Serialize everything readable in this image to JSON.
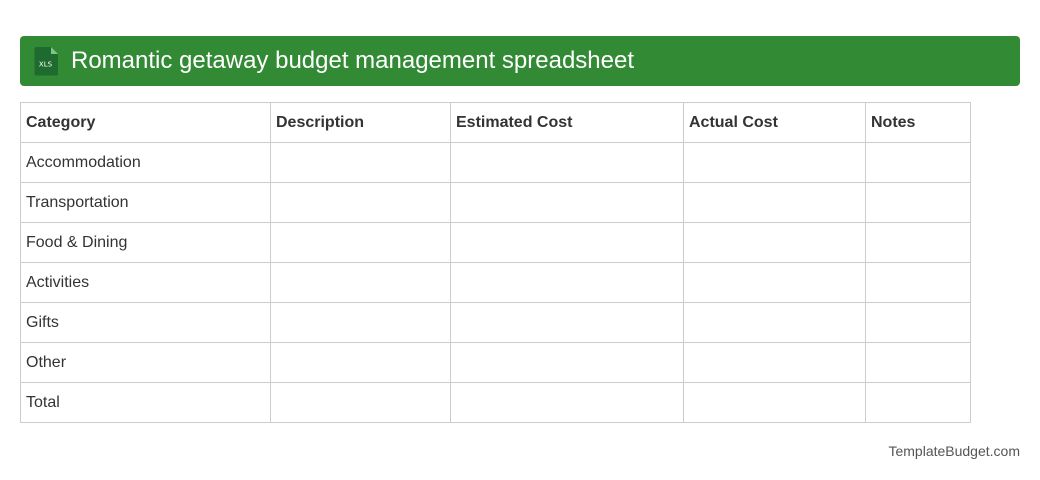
{
  "header": {
    "icon": "xls-file-icon",
    "icon_label": "XLS",
    "title": "Romantic getaway budget management spreadsheet",
    "background_color": "#338a35"
  },
  "table": {
    "columns": [
      "Category",
      "Description",
      "Estimated Cost",
      "Actual Cost",
      "Notes"
    ],
    "rows": [
      [
        "Accommodation",
        "",
        "",
        "",
        ""
      ],
      [
        "Transportation",
        "",
        "",
        "",
        ""
      ],
      [
        "Food & Dining",
        "",
        "",
        "",
        ""
      ],
      [
        "Activities",
        "",
        "",
        "",
        ""
      ],
      [
        "Gifts",
        "",
        "",
        "",
        ""
      ],
      [
        "Other",
        "",
        "",
        "",
        ""
      ],
      [
        "Total",
        "",
        "",
        "",
        ""
      ]
    ]
  },
  "footer": {
    "brand": "TemplateBudget.com"
  }
}
